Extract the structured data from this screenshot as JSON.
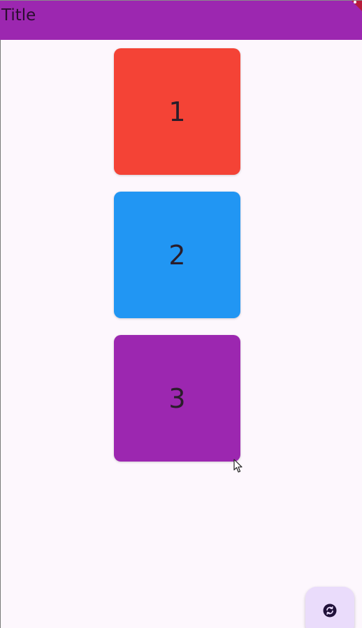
{
  "appbar": {
    "title": "Title",
    "background": "#9c27b0"
  },
  "tiles": [
    {
      "label": "1",
      "color": "#f44336"
    },
    {
      "label": "2",
      "color": "#2196f3"
    },
    {
      "label": "3",
      "color": "#9c27b0"
    }
  ],
  "fab": {
    "icon": "refresh-icon",
    "background": "#eadcfb"
  },
  "debug_banner": {
    "color": "#b71c3c"
  }
}
